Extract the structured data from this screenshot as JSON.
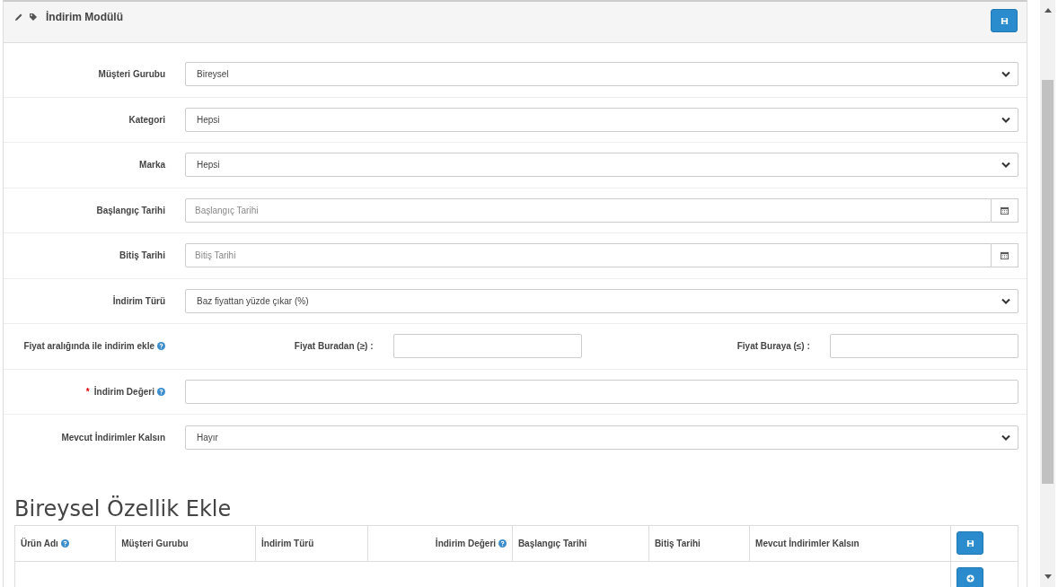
{
  "panel": {
    "title": "İndirim Modülü"
  },
  "fields": [
    {
      "kind": "select",
      "label": "Müşteri Gurubu",
      "value": "Bireysel"
    },
    {
      "kind": "select",
      "label": "Kategori",
      "value": "Hepsi"
    },
    {
      "kind": "select",
      "label": "Marka",
      "value": "Hepsi"
    },
    {
      "kind": "date",
      "label": "Başlangıç Tarihi",
      "placeholder": "Başlangıç Tarihi"
    },
    {
      "kind": "date",
      "label": "Bitiş Tarihi",
      "placeholder": "Bitiş Tarihi"
    },
    {
      "kind": "select",
      "label": "İndirim Türü",
      "value": "Baz fiyattan yüzde çıkar (%)"
    },
    {
      "kind": "range",
      "label": "Fiyat aralığında ile indirim ekle",
      "help": true,
      "from_label": "Fiyat Buradan (≥) :",
      "to_label": "Fiyat Buraya (≤) :"
    },
    {
      "kind": "text",
      "label": "İndirim Değeri",
      "help": true,
      "required_mark": "*"
    },
    {
      "kind": "select",
      "label": "Mevcut İndirimler Kalsın",
      "value": "Hayır"
    }
  ],
  "section": {
    "title": "Bireysel Özellik Ekle",
    "columns": [
      {
        "label": "Ürün Adı",
        "help": true
      },
      {
        "label": "Müşteri Gurubu",
        "help": false
      },
      {
        "label": "İndirim Türü",
        "help": false
      },
      {
        "label": "İndirim Değeri",
        "help": true
      },
      {
        "label": "Başlangıç Tarihi",
        "help": false
      },
      {
        "label": "Bitiş Tarihi",
        "help": false
      },
      {
        "label": "Mevcut İndirimler Kalsın",
        "help": false
      }
    ]
  }
}
